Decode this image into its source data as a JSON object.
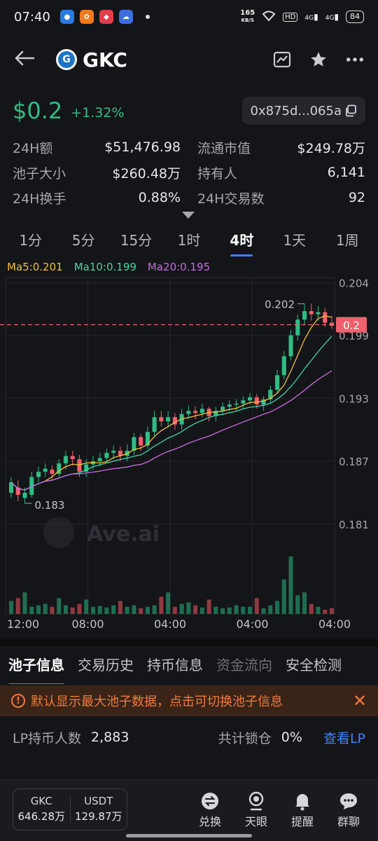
{
  "status": {
    "time": "07:40",
    "speed_top": "165",
    "speed_bottom": "KB/S",
    "hd": "HD",
    "net1": "4G",
    "net2": "4G",
    "battery": "84"
  },
  "header": {
    "title": "GKC",
    "logo_letter": "G"
  },
  "token": {
    "price": "$0.2",
    "change": "+1.32%",
    "address": "0x875d...065a"
  },
  "stats": [
    {
      "k": "24H额",
      "v": "$51,476.98"
    },
    {
      "k": "流通市值",
      "v": "$249.78万"
    },
    {
      "k": "池子大小",
      "v": "$260.48万"
    },
    {
      "k": "持有人",
      "v": "6,141"
    },
    {
      "k": "24H换手",
      "v": "0.88%"
    },
    {
      "k": "24H交易数",
      "v": "92"
    }
  ],
  "timeframes": [
    "1分",
    "5分",
    "15分",
    "1时",
    "4时",
    "1天",
    "1周"
  ],
  "active_timeframe": 4,
  "ma": {
    "ma5": "Ma5:0.201",
    "ma10": "Ma10:0.199",
    "ma20": "Ma20:0.195"
  },
  "colors": {
    "up": "#2fbd85",
    "down": "#f0616d",
    "ma5": "#f1c232",
    "ma10": "#3fd6a4",
    "ma20": "#c86be0",
    "accent": "#3e82f7",
    "warning": "#f07b3f"
  },
  "chart_data": {
    "type": "candlestick",
    "y_ticks": [
      "0.204",
      "0.199",
      "0.193",
      "0.187",
      "0.181"
    ],
    "ylim": [
      0.179,
      0.2045
    ],
    "x_ticks": [
      "12:00",
      "08:00",
      "04:00",
      "04:00",
      "04:00"
    ],
    "current_price_label": "0.2",
    "current_price": 0.2,
    "high_label": "0.202",
    "low_label": "0.183",
    "watermark": "Ave.ai",
    "candles": [
      [
        0.184,
        0.185,
        0.1835,
        0.1855
      ],
      [
        0.1845,
        0.1838,
        0.1832,
        0.1852
      ],
      [
        0.1835,
        0.184,
        0.183,
        0.1845
      ],
      [
        0.1838,
        0.1855,
        0.1835,
        0.186
      ],
      [
        0.1855,
        0.186,
        0.185,
        0.1865
      ],
      [
        0.186,
        0.1863,
        0.1855,
        0.1868
      ],
      [
        0.1862,
        0.1858,
        0.1853,
        0.1866
      ],
      [
        0.1858,
        0.1868,
        0.1855,
        0.1872
      ],
      [
        0.1868,
        0.1875,
        0.1862,
        0.188
      ],
      [
        0.1875,
        0.1872,
        0.1866,
        0.188
      ],
      [
        0.1872,
        0.186,
        0.1855,
        0.1876
      ],
      [
        0.186,
        0.1867,
        0.1855,
        0.1872
      ],
      [
        0.1867,
        0.187,
        0.1862,
        0.1875
      ],
      [
        0.187,
        0.1873,
        0.1865,
        0.1878
      ],
      [
        0.1873,
        0.1878,
        0.1868,
        0.1882
      ],
      [
        0.1878,
        0.188,
        0.1872,
        0.1885
      ],
      [
        0.188,
        0.1875,
        0.187,
        0.1884
      ],
      [
        0.1875,
        0.188,
        0.187,
        0.1886
      ],
      [
        0.188,
        0.1893,
        0.1876,
        0.1897
      ],
      [
        0.1893,
        0.1885,
        0.188,
        0.1896
      ],
      [
        0.1885,
        0.1898,
        0.1882,
        0.1903
      ],
      [
        0.1898,
        0.1912,
        0.1893,
        0.1918
      ],
      [
        0.1912,
        0.1908,
        0.1903,
        0.1918
      ],
      [
        0.1908,
        0.1912,
        0.1902,
        0.1918
      ],
      [
        0.1912,
        0.1905,
        0.19,
        0.1916
      ],
      [
        0.1905,
        0.1915,
        0.19,
        0.192
      ],
      [
        0.1915,
        0.1918,
        0.191,
        0.1923
      ],
      [
        0.1918,
        0.1916,
        0.191,
        0.1922
      ],
      [
        0.1916,
        0.192,
        0.1912,
        0.1925
      ],
      [
        0.192,
        0.1913,
        0.1908,
        0.1922
      ],
      [
        0.1913,
        0.1918,
        0.1908,
        0.1922
      ],
      [
        0.1918,
        0.1922,
        0.1914,
        0.1926
      ],
      [
        0.1922,
        0.1924,
        0.1918,
        0.1928
      ],
      [
        0.1924,
        0.1925,
        0.1918,
        0.1929
      ],
      [
        0.1925,
        0.1928,
        0.192,
        0.1932
      ],
      [
        0.1928,
        0.1931,
        0.1924,
        0.1935
      ],
      [
        0.1931,
        0.1924,
        0.192,
        0.1934
      ],
      [
        0.1924,
        0.1929,
        0.1918,
        0.1932
      ],
      [
        0.1929,
        0.1938,
        0.1925,
        0.1942
      ],
      [
        0.1938,
        0.1952,
        0.1935,
        0.1957
      ],
      [
        0.1952,
        0.197,
        0.1948,
        0.1975
      ],
      [
        0.197,
        0.199,
        0.1966,
        0.1995
      ],
      [
        0.199,
        0.2005,
        0.1985,
        0.201
      ],
      [
        0.2005,
        0.2013,
        0.2,
        0.202
      ],
      [
        0.2013,
        0.201,
        0.2004,
        0.202
      ],
      [
        0.201,
        0.2012,
        0.2004,
        0.2018
      ],
      [
        0.2012,
        0.2002,
        0.1998,
        0.2016
      ],
      [
        0.2002,
        0.1999,
        0.1996,
        0.2008
      ]
    ],
    "volumes": [
      18,
      22,
      30,
      10,
      12,
      14,
      10,
      22,
      12,
      9,
      14,
      20,
      10,
      11,
      9,
      12,
      18,
      10,
      12,
      8,
      10,
      12,
      24,
      30,
      10,
      14,
      16,
      12,
      9,
      20,
      10,
      8,
      9,
      12,
      10,
      10,
      22,
      8,
      12,
      18,
      48,
      80,
      26,
      30,
      14,
      10,
      6,
      8
    ]
  },
  "tabs": [
    "池子信息",
    "交易历史",
    "持币信息",
    "资金流向",
    "安全检测"
  ],
  "active_tab": 0,
  "notice": {
    "text": "默认显示最大池子数据，点击可切换池子信息"
  },
  "lp": {
    "holders_label": "LP持币人数",
    "holders_value": "2,883",
    "lock_label": "共计锁仓",
    "lock_value": "0%",
    "link": "查看LP"
  },
  "bottom": {
    "pair": [
      {
        "name": "GKC",
        "amount": "646.28万"
      },
      {
        "name": "USDT",
        "amount": "129.87万"
      }
    ],
    "nav": [
      "兑换",
      "天眼",
      "提醒",
      "群聊"
    ]
  }
}
